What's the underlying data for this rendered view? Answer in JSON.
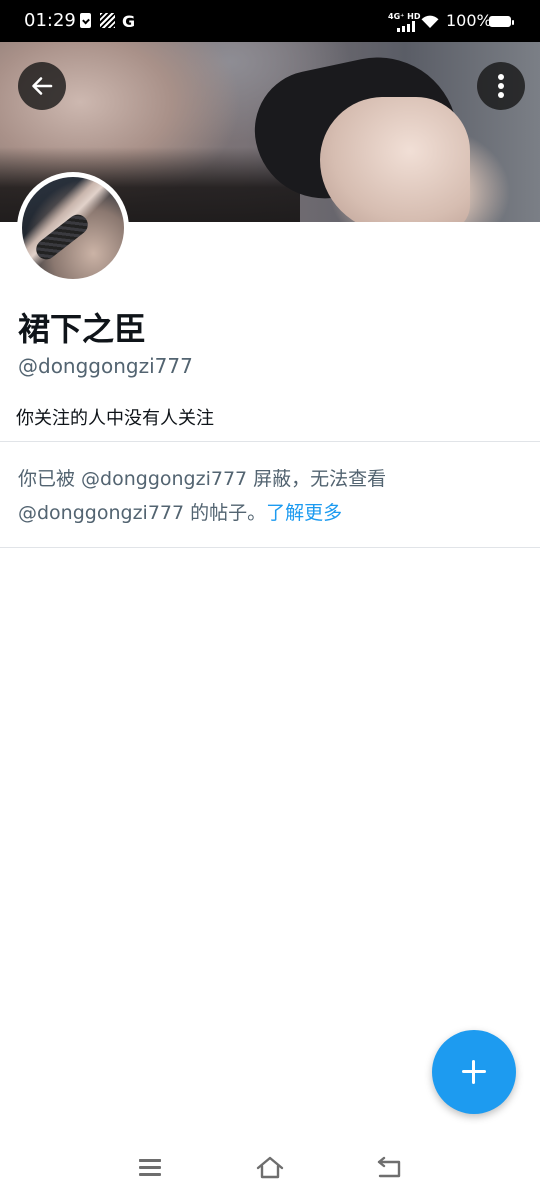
{
  "status_bar": {
    "time": "01:29",
    "network": "4G⁺ HD",
    "battery_percent": "100%",
    "g_label": "G"
  },
  "profile": {
    "display_name": "裙下之臣",
    "handle": "@donggongzi777",
    "followers_note": "你关注的人中没有人关注"
  },
  "blocked_notice": {
    "text": "你已被 @donggongzi777 屏蔽，无法查看 @donggongzi777 的帖子。",
    "link_label": "了解更多"
  },
  "icons": {
    "back": "arrow-left-icon",
    "menu": "more-vertical-icon",
    "fab": "plus-icon",
    "nav_recents": "hamburger-icon",
    "nav_home": "home-icon",
    "nav_back": "return-icon"
  },
  "colors": {
    "accent": "#1d9bf0",
    "text_primary": "#0f1419",
    "text_secondary": "#536471"
  }
}
